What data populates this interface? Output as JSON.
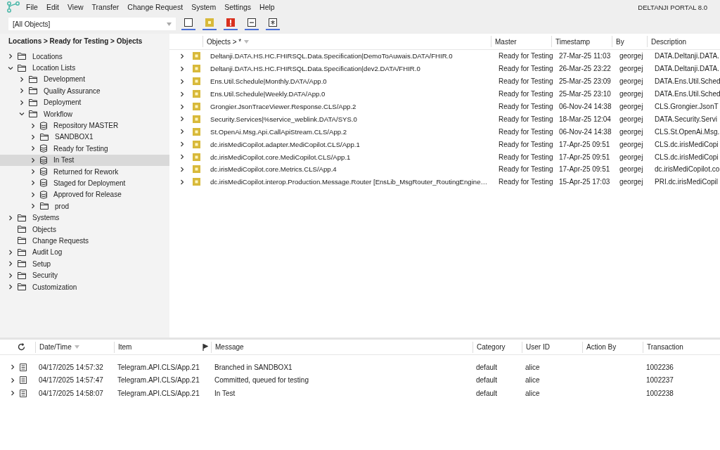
{
  "menu": [
    "File",
    "Edit",
    "View",
    "Transfer",
    "Change Request",
    "System",
    "Settings",
    "Help"
  ],
  "app_title": "DELTANJI PORTAL 8.0",
  "scope_select": {
    "value": "[All Objects]"
  },
  "filters": [
    {
      "kind": "empty"
    },
    {
      "kind": "dot"
    },
    {
      "kind": "alert"
    },
    {
      "kind": "minus"
    },
    {
      "kind": "star"
    }
  ],
  "breadcrumb": "Locations > Ready for Testing > Objects",
  "tree": [
    {
      "label": "Locations",
      "kind": "folder",
      "expanded": false,
      "selected": false
    },
    {
      "label": "Location Lists",
      "kind": "folder",
      "expanded": true,
      "selected": false,
      "children": [
        {
          "label": "Development",
          "kind": "folder",
          "expanded": false,
          "selected": false
        },
        {
          "label": "Quality Assurance",
          "kind": "folder",
          "expanded": false,
          "selected": false
        },
        {
          "label": "Deployment",
          "kind": "folder",
          "expanded": false,
          "selected": false
        },
        {
          "label": "Workflow",
          "kind": "folder",
          "expanded": true,
          "selected": false,
          "children": [
            {
              "label": "Repository MASTER",
              "kind": "database",
              "expanded": false,
              "selected": false
            },
            {
              "label": "SANDBOX1",
              "kind": "folder",
              "expanded": false,
              "selected": false
            },
            {
              "label": "Ready for Testing",
              "kind": "database",
              "expanded": false,
              "selected": false
            },
            {
              "label": "In Test",
              "kind": "database",
              "expanded": false,
              "selected": true
            },
            {
              "label": "Returned for Rework",
              "kind": "database",
              "expanded": false,
              "selected": false
            },
            {
              "label": "Staged for Deployment",
              "kind": "database",
              "expanded": false,
              "selected": false
            },
            {
              "label": "Approved for Release",
              "kind": "database",
              "expanded": false,
              "selected": false
            },
            {
              "label": "prod",
              "kind": "folder",
              "expanded": false,
              "selected": false
            }
          ]
        }
      ]
    },
    {
      "label": "Systems",
      "kind": "folder",
      "expanded": false,
      "selected": false
    },
    {
      "label": "Objects",
      "kind": "folder",
      "selected": false
    },
    {
      "label": "Change Requests",
      "kind": "folder",
      "selected": false
    },
    {
      "label": "Audit Log",
      "kind": "folder",
      "expanded": false,
      "selected": false
    },
    {
      "label": "Setup",
      "kind": "folder",
      "expanded": false,
      "selected": false
    },
    {
      "label": "Security",
      "kind": "folder",
      "expanded": false,
      "selected": false
    },
    {
      "label": "Customization",
      "kind": "folder",
      "expanded": false,
      "selected": false
    }
  ],
  "objects_table": {
    "columns": [
      "Objects > *",
      "Master",
      "Timestamp",
      "By",
      "Description"
    ],
    "rows": [
      [
        "Deltanji.DATA.HS.HC.FHIRSQL.Data.Specification|DemoToAuwais.DATA/FHIR.0",
        "Ready for Testing",
        "27-Mar-25 11:03",
        "georgej",
        "DATA.Deltanji.DATA."
      ],
      [
        "Deltanji.DATA.HS.HC.FHIRSQL.Data.Specification|dev2.DATA/FHIR.0",
        "Ready for Testing",
        "26-Mar-25 23:22",
        "georgej",
        "DATA.Deltanji.DATA."
      ],
      [
        "Ens.Util.Schedule|Monthly.DATA/App.0",
        "Ready for Testing",
        "25-Mar-25 23:09",
        "georgej",
        "DATA.Ens.Util.Sched"
      ],
      [
        "Ens.Util.Schedule|Weekly.DATA/App.0",
        "Ready for Testing",
        "25-Mar-25 23:10",
        "georgej",
        "DATA.Ens.Util.Sched"
      ],
      [
        "Grongier.JsonTraceViewer.Response.CLS/App.2",
        "Ready for Testing",
        "06-Nov-24 14:38",
        "georgej",
        "CLS.Grongier.JsonT"
      ],
      [
        "Security.Services|%service_weblink.DATA/SYS.0",
        "Ready for Testing",
        "18-Mar-25 12:04",
        "georgej",
        "DATA.Security.Servi"
      ],
      [
        "St.OpenAi.Msg.Api.CallApiStream.CLS/App.2",
        "Ready for Testing",
        "06-Nov-24 14:38",
        "georgej",
        "CLS.St.OpenAi.Msg."
      ],
      [
        "dc.irisMediCopilot.adapter.MediCopilot.CLS/App.1",
        "Ready for Testing",
        "17-Apr-25 09:51",
        "georgej",
        "CLS.dc.irisMediCopi"
      ],
      [
        "dc.irisMediCopilot.core.MediCopilot.CLS/App.1",
        "Ready for Testing",
        "17-Apr-25 09:51",
        "georgej",
        "CLS.dc.irisMediCopi"
      ],
      [
        "dc.irisMediCopilot.core.Metrics.CLS/App.4",
        "Ready for Testing",
        "17-Apr-25 09:51",
        "georgej",
        "dc.irisMediCopilot.co"
      ],
      [
        "dc.irisMediCopilot.interop.Production.Message.Router [EnsLib_MsgRouter_RoutingEngine…",
        "Ready for Testing",
        "15-Apr-25 17:03",
        "georgej",
        "PRI.dc.irisMediCopil"
      ]
    ]
  },
  "audit_table": {
    "columns": [
      "Date/Time",
      "Item",
      "Message",
      "Category",
      "User ID",
      "Action By",
      "Transaction"
    ],
    "rows": [
      [
        "04/17/2025 14:57:32",
        "Telegram.API.CLS/App.21",
        "Branched in SANDBOX1",
        "default",
        "alice",
        "",
        "1002236"
      ],
      [
        "04/17/2025 14:57:47",
        "Telegram.API.CLS/App.21",
        "Committed, queued for testing",
        "default",
        "alice",
        "",
        "1002237"
      ],
      [
        "04/17/2025 14:58:07",
        "Telegram.API.CLS/App.21",
        "In Test",
        "default",
        "alice",
        "",
        "1002238"
      ]
    ]
  }
}
